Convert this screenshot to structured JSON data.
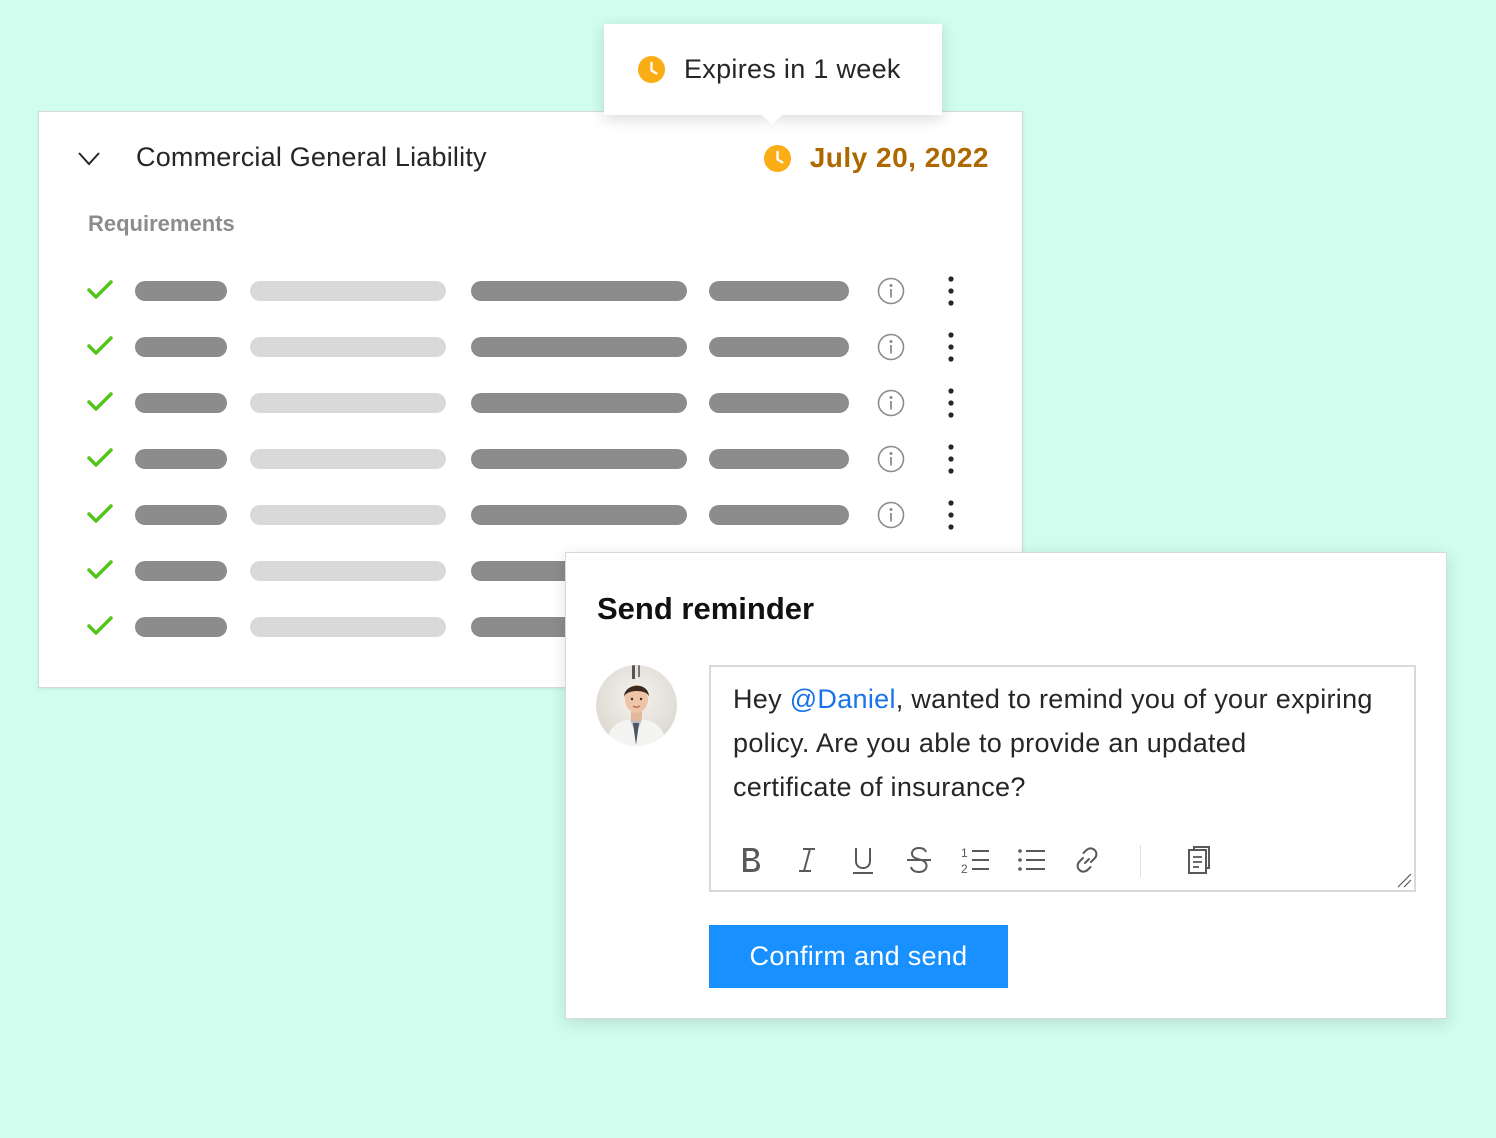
{
  "colors": {
    "background": "#d0fdee",
    "accent": "#1890ff",
    "warning": "#faad14",
    "warning_text": "#ad6800",
    "success": "#52c41a",
    "mention": "#1a73e8"
  },
  "tooltip": {
    "icon": "clock-icon",
    "text": "Expires in 1 week"
  },
  "policy": {
    "collapse_icon": "chevron-down-icon",
    "title": "Commercial General Liability",
    "expiry_icon": "clock-icon",
    "expiry_date": "July 20, 2022",
    "requirements_label": "Requirements",
    "row_icons": [
      "check-icon",
      "info-icon",
      "more-vertical-icon"
    ]
  },
  "reminder": {
    "title": "Send reminder",
    "message": {
      "greeting": "Hey ",
      "mention": "@Daniel",
      "body": ", wanted to remind you of your expiring policy. Are you able to provide an updated certificate of insurance?"
    },
    "toolbar_icons": [
      "bold-icon",
      "italic-icon",
      "underline-icon",
      "strikethrough-icon",
      "ordered-list-icon",
      "bullet-list-icon",
      "link-icon",
      "clipboard-icon"
    ],
    "send_label": "Confirm and send"
  }
}
